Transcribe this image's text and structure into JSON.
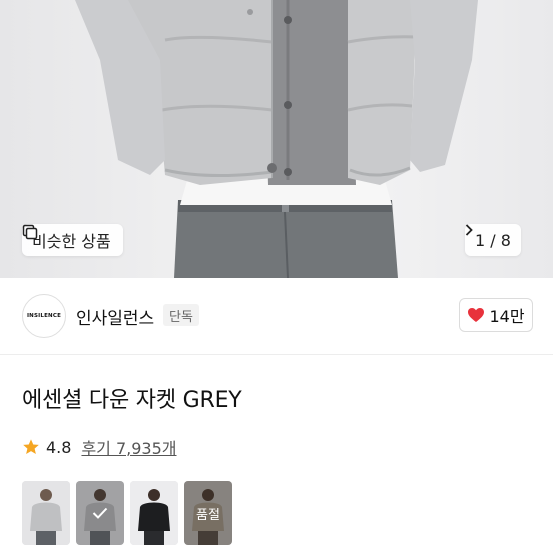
{
  "hero": {
    "similar_label": "비슷한 상품",
    "pager": {
      "current": "1",
      "separator": "/",
      "total": "8"
    }
  },
  "brand": {
    "logo_text": "INSILENCE",
    "name": "인사일런스",
    "badge": "단독",
    "likes": "14만"
  },
  "product": {
    "title": "에센셜 다운 자켓 GREY",
    "rating": "4.8",
    "reviews": "후기 7,935개"
  },
  "thumbnails": [
    {
      "variant": "grey",
      "selected": false,
      "status": ""
    },
    {
      "variant": "grey",
      "selected": true,
      "status": ""
    },
    {
      "variant": "black",
      "selected": false,
      "status": ""
    },
    {
      "variant": "beige",
      "selected": false,
      "status": "품절"
    }
  ],
  "colors": {
    "heart": "#e8323c",
    "star": "#f5a623",
    "jacket": "#c9cacc",
    "cardigan": "#8c8d8f",
    "jeans": "#6f7378"
  },
  "icons": {
    "similar": "copy-icon",
    "pager_next": "chevron-right-icon",
    "like": "heart-icon",
    "rating": "star-icon"
  }
}
